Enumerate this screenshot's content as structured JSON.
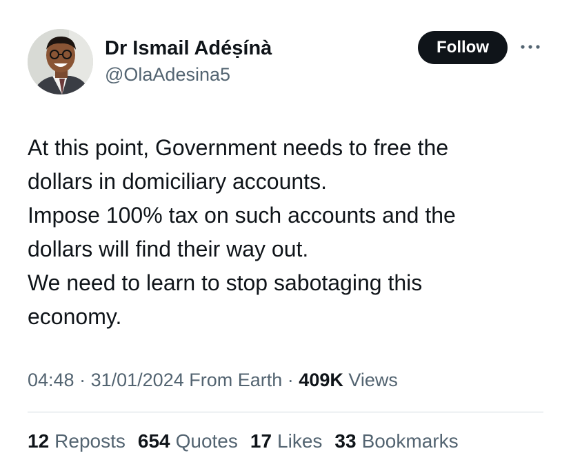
{
  "author": {
    "display_name": "Dr Ismail Adéṣínà",
    "handle": "@OlaAdesina5"
  },
  "follow_label": "Follow",
  "tweet": {
    "lines": [
      "At this point, Government needs to free the",
      "dollars in domiciliary accounts.",
      "Impose 100% tax on such accounts and the",
      "dollars will find their way out.",
      "We need to learn to stop sabotaging this",
      "economy."
    ]
  },
  "meta": {
    "time": "04:48",
    "date": "31/01/2024",
    "source": "From Earth",
    "views_count": "409K",
    "views_label": "Views"
  },
  "stats": {
    "reposts": {
      "count": "12",
      "label": "Reposts"
    },
    "quotes": {
      "count": "654",
      "label": "Quotes"
    },
    "likes": {
      "count": "17",
      "label": "Likes"
    },
    "bookmarks": {
      "count": "33",
      "label": "Bookmarks"
    }
  },
  "colors": {
    "text_primary": "#0f1419",
    "text_secondary": "#536471",
    "button_bg": "#0f1419",
    "divider": "#cfd9de"
  },
  "icons": {
    "more": "more-horizontal-icon"
  }
}
